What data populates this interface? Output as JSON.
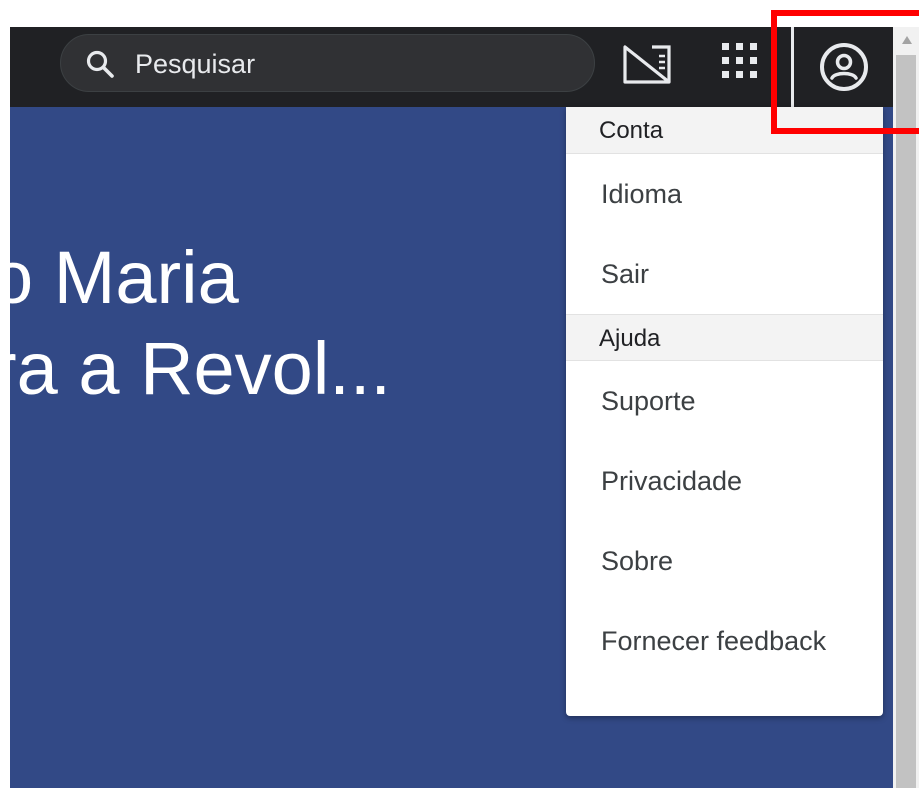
{
  "search": {
    "placeholder": "Pesquisar"
  },
  "header_icons": [
    "search-icon",
    "cast-icon",
    "apps-grid-icon",
    "account-circle-icon"
  ],
  "hero": {
    "line1": "o Maria",
    "line2": "ra a Revol..."
  },
  "account_menu": {
    "section_account": "Conta",
    "account_items": [
      "Idioma",
      "Sair"
    ],
    "section_help": "Ajuda",
    "help_items": [
      "Suporte",
      "Privacidade",
      "Sobre",
      "Fornecer feedback"
    ]
  },
  "colors": {
    "topbar": "#202124",
    "hero_background": "#324986",
    "highlight": "#ff0000"
  }
}
